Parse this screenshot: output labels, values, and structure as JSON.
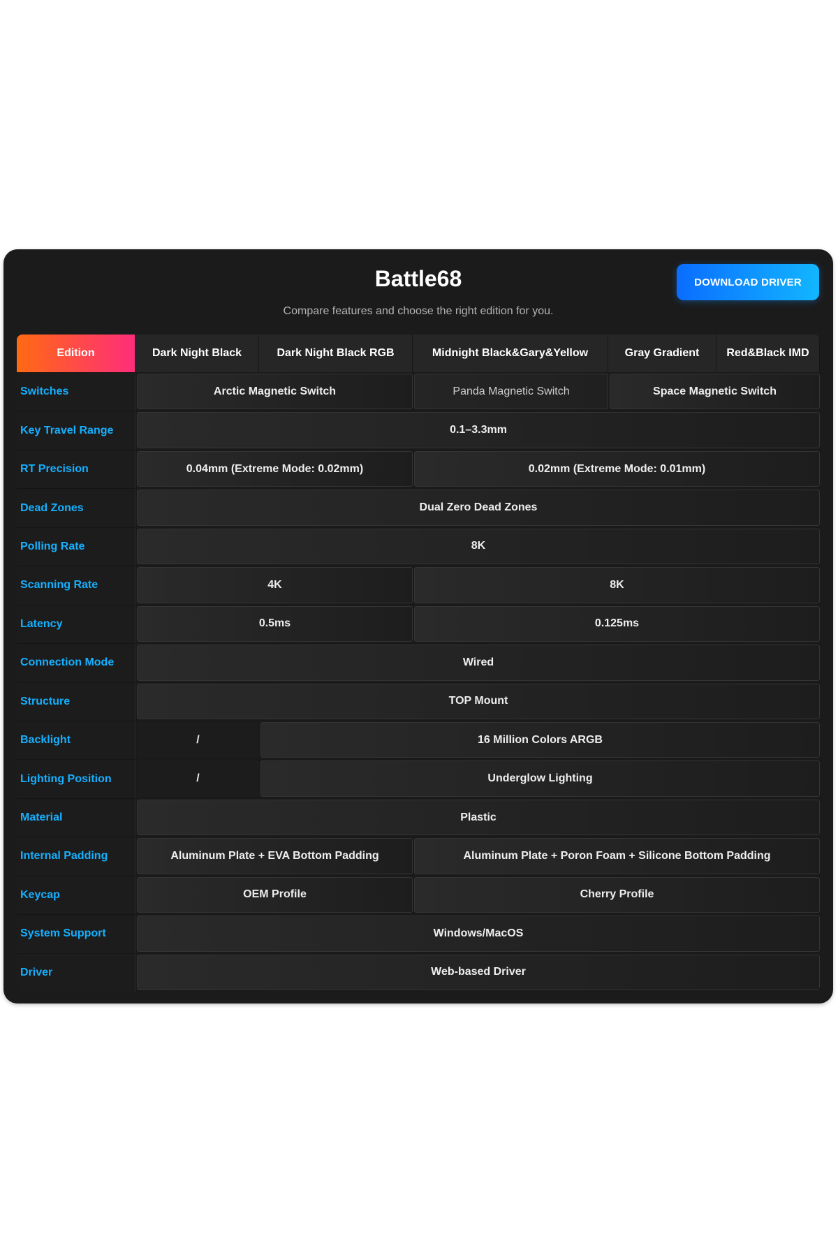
{
  "header": {
    "title": "Battle68",
    "subtitle": "Compare features and choose the right edition for you.",
    "download_label": "DOWNLOAD DRIVER"
  },
  "table": {
    "columns": [
      "Edition",
      "Dark Night Black",
      "Dark Night Black RGB",
      "Midnight Black&Gary&Yellow",
      "Gray Gradient",
      "Red&Black IMD"
    ],
    "rows": [
      {
        "label": "Switches",
        "cells": [
          {
            "text": "Arctic Magnetic Switch",
            "span": 2
          },
          {
            "text": "Panda Magnetic Switch",
            "span": 1
          },
          {
            "text": "Space Magnetic Switch",
            "span": 2
          }
        ]
      },
      {
        "label": "Key Travel Range",
        "cells": [
          {
            "text": "0.1–3.3mm",
            "span": 5
          }
        ]
      },
      {
        "label": "RT Precision",
        "cells": [
          {
            "text": "0.04mm (Extreme Mode: 0.02mm)",
            "span": 2
          },
          {
            "text": "0.02mm (Extreme Mode: 0.01mm)",
            "span": 3
          }
        ]
      },
      {
        "label": "Dead Zones",
        "cells": [
          {
            "text": "Dual Zero Dead Zones",
            "span": 5
          }
        ]
      },
      {
        "label": "Polling Rate",
        "cells": [
          {
            "text": "8K",
            "span": 5
          }
        ]
      },
      {
        "label": "Scanning Rate",
        "cells": [
          {
            "text": "4K",
            "span": 2
          },
          {
            "text": "8K",
            "span": 3
          }
        ]
      },
      {
        "label": "Latency",
        "cells": [
          {
            "text": "0.5ms",
            "span": 2
          },
          {
            "text": "0.125ms",
            "span": 3
          }
        ]
      },
      {
        "label": "Connection Mode",
        "cells": [
          {
            "text": "Wired",
            "span": 5
          }
        ]
      },
      {
        "label": "Structure",
        "cells": [
          {
            "text": "TOP Mount",
            "span": 5
          }
        ]
      },
      {
        "label": "Backlight",
        "cells": [
          {
            "text": "/",
            "span": 1
          },
          {
            "text": "16 Million Colors ARGB",
            "span": 4
          }
        ]
      },
      {
        "label": "Lighting Position",
        "cells": [
          {
            "text": "/",
            "span": 1
          },
          {
            "text": "Underglow Lighting",
            "span": 4
          }
        ]
      },
      {
        "label": "Material",
        "cells": [
          {
            "text": "Plastic",
            "span": 5
          }
        ]
      },
      {
        "label": "Internal Padding",
        "cells": [
          {
            "text": "Aluminum Plate + EVA Bottom Padding",
            "span": 2
          },
          {
            "text": "Aluminum Plate + Poron Foam + Silicone Bottom Padding",
            "span": 3
          }
        ]
      },
      {
        "label": "Keycap",
        "cells": [
          {
            "text": "OEM Profile",
            "span": 2
          },
          {
            "text": "Cherry Profile",
            "span": 3
          }
        ]
      },
      {
        "label": "System Support",
        "cells": [
          {
            "text": "Windows/MacOS",
            "span": 5
          }
        ]
      },
      {
        "label": "Driver",
        "cells": [
          {
            "text": "Web-based Driver",
            "span": 5
          }
        ]
      }
    ]
  },
  "colors": {
    "accent_blue": "#16b0ff",
    "edition_gradient_start": "#ff6a13",
    "edition_gradient_end": "#ff2d7a",
    "card_background": "#1b1b1b"
  }
}
